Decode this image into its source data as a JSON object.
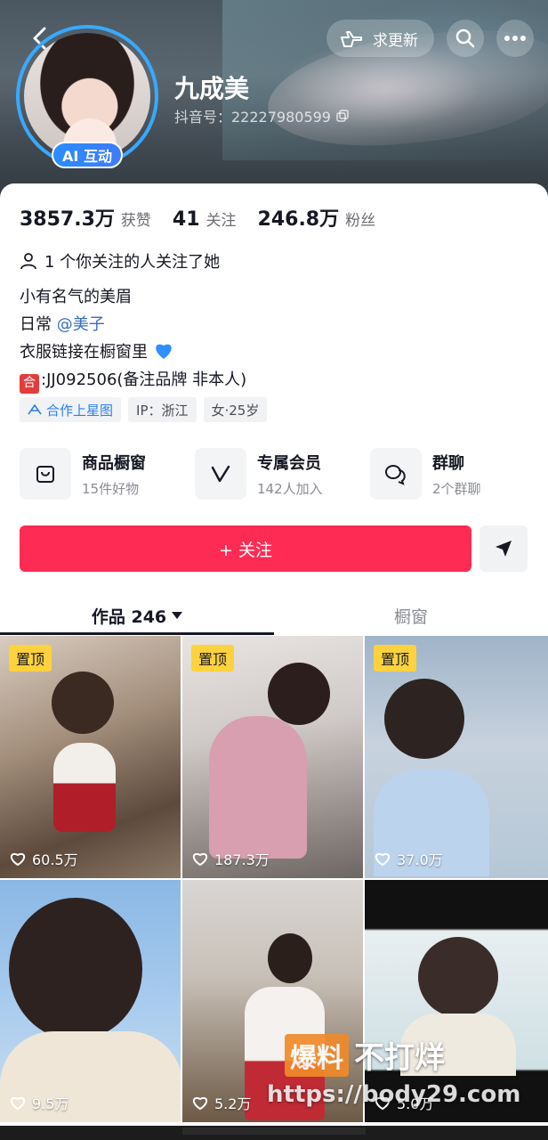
{
  "header": {
    "update_label": "求更新",
    "username": "九成美",
    "douyin_id_label": "抖音号：22227980599",
    "ai_badge": "AI 互动"
  },
  "stats": [
    {
      "value": "3857.3万",
      "label": "获赞"
    },
    {
      "value": "41",
      "label": "关注"
    },
    {
      "value": "246.8万",
      "label": "粉丝"
    }
  ],
  "mutual_text": "1 个你关注的人关注了她",
  "bio": {
    "line1": "小有名气的美眉",
    "line2_prefix": "日常 ",
    "line2_mention": "@美子",
    "line3": "衣服链接在橱窗里",
    "line4_tag": "合",
    "line4": ":JJ092506(备注品牌 非本人)"
  },
  "chips": [
    "合作上星图",
    "IP：浙江",
    "女·25岁"
  ],
  "services": [
    {
      "title": "商品橱窗",
      "sub": "15件好物",
      "icon": "shop-bag-icon"
    },
    {
      "title": "专属会员",
      "sub": "142人加入",
      "icon": "member-v-icon"
    },
    {
      "title": "群聊",
      "sub": "2个群聊",
      "icon": "group-chat-icon"
    }
  ],
  "follow_label": "+ 关注",
  "tabs": {
    "works": "作品 246",
    "shop": "橱窗"
  },
  "videos": [
    {
      "pinned": "置顶",
      "likes": "60.5万"
    },
    {
      "pinned": "置顶",
      "likes": "187.3万"
    },
    {
      "pinned": "置顶",
      "likes": "37.0万"
    },
    {
      "pinned": "",
      "likes": "9.5万"
    },
    {
      "pinned": "",
      "likes": "5.2万"
    },
    {
      "pinned": "",
      "likes": "5.0万"
    }
  ],
  "watermark": {
    "box": "爆料",
    "text": "不打烊",
    "url": "https://body29.com"
  },
  "colors": {
    "accent": "#fe2c55",
    "pin": "#fdd23c",
    "avatar_ring": "#39a9ff",
    "mention": "#3a6cc0"
  }
}
